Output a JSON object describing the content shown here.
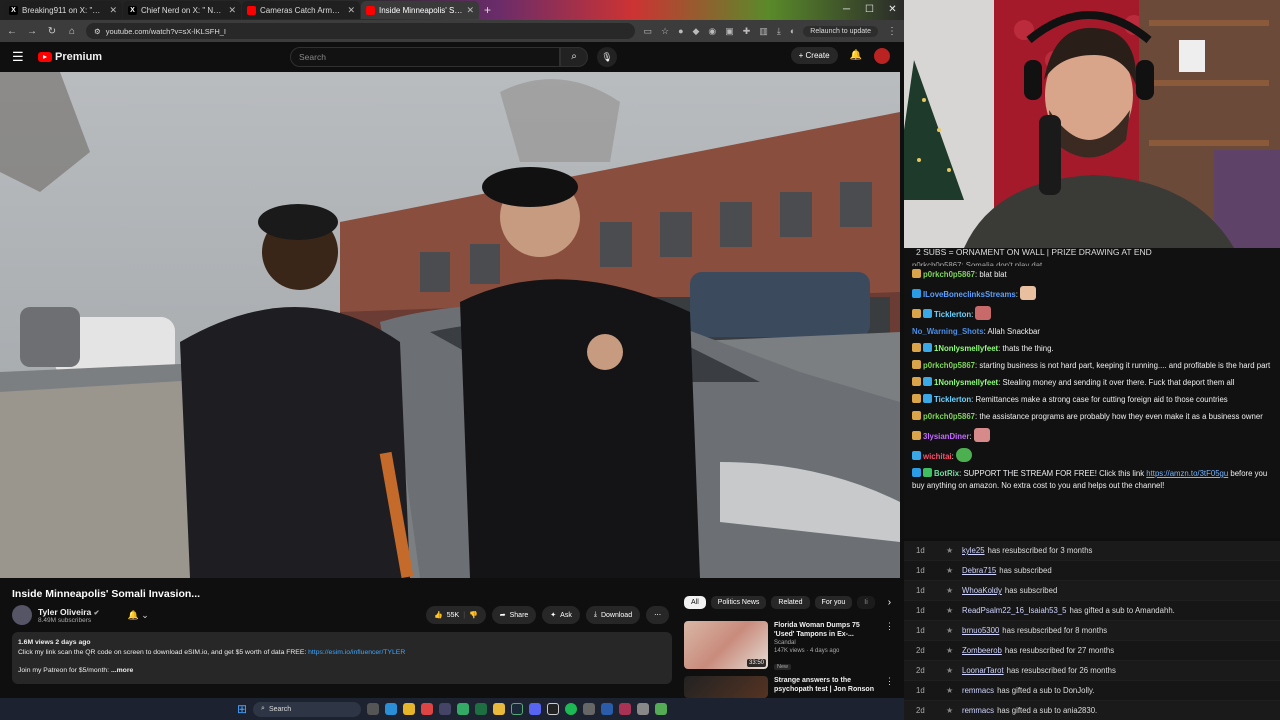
{
  "browser": {
    "tabs": [
      {
        "title": "Breaking911 on X: \"Rep. C",
        "favicon": "x-icon"
      },
      {
        "title": "Chief Nerd on X: \" NEW",
        "favicon": "x-icon"
      },
      {
        "title": "Cameras Catch Armed Robber",
        "favicon": "youtube-icon"
      },
      {
        "title": "Inside Minneapolis' Somali",
        "favicon": "youtube-icon",
        "active": true
      }
    ],
    "url": "youtube.com/watch?v=sX-lKLSFH_I",
    "relaunch_label": "Relaunch to update"
  },
  "youtube": {
    "brand": "Premium",
    "search_placeholder": "Search",
    "create_label": "Create",
    "video_title": "Inside Minneapolis' Somali Invasion...",
    "channel_name": "Tyler Oliveira",
    "channel_subs": "8.49M subscribers",
    "likes": "55K",
    "share_label": "Share",
    "ask_label": "Ask",
    "download_label": "Download",
    "description": {
      "meta": "1.6M views  2 days ago",
      "line1": "Click my link scan the QR code on screen to download eSIM.io, and get $5 worth of data FREE: ",
      "link": "https://esim.io/influencer/TYLER",
      "line2": "Join my Patreon for $5/month:",
      "more": "...more"
    },
    "chips": [
      "All",
      "Politics News",
      "Related",
      "For you",
      "Ii"
    ],
    "recommendations": [
      {
        "title": "Florida Woman Dumps 75 'Used' Tampons in Ex-...",
        "channel": "Scandal",
        "meta": "147K views · 4 days ago",
        "badge": "New",
        "duration": "33:50"
      },
      {
        "title": "Strange answers to the psychopath test | Jon Ronson ...",
        "channel": "",
        "meta": "",
        "badge": "",
        "duration": ""
      }
    ]
  },
  "taskbar": {
    "search_label": "Search"
  },
  "chat": {
    "banner": "2 SUBS = ORNAMENT ON WALL | PRIZE DRAWING AT END",
    "partial_top": "p0rkch0p5867: Somalia don't play dat",
    "messages": [
      {
        "user": "p0rkch0p5867",
        "color": "#7fd45a",
        "text": "blat blat"
      },
      {
        "user": "ILoveBoneclinksStreams",
        "color": "#5aa0ff",
        "text": ""
      },
      {
        "user": "Ticklerton",
        "color": "#6ad3ff",
        "text": ""
      },
      {
        "user": "No_Warning_Shots",
        "color": "#4b8ee6",
        "text": "Allah Snackbar"
      },
      {
        "user": "1Nonlysmellyfeet",
        "color": "#8eff7a",
        "text": "thats the thing."
      },
      {
        "user": "p0rkch0p5867",
        "color": "#7fd45a",
        "text": "starting business is not hard part, keeping it running.... and profitable is the hard part"
      },
      {
        "user": "1Nonlysmellyfeet",
        "color": "#8eff7a",
        "text": "Stealing money and sending it over there. Fuck that deport them all"
      },
      {
        "user": "Ticklerton",
        "color": "#6ad3ff",
        "text": "Remittances make a strong case for cutting foreign aid to those countries"
      },
      {
        "user": "p0rkch0p5867",
        "color": "#7fd45a",
        "text": "the assistance programs are probably how they even make it as a business owner"
      },
      {
        "user": "3lysianDiner",
        "color": "#c46bff",
        "text": ""
      },
      {
        "user": "wichitai",
        "color": "#ff4d6a",
        "text": ""
      },
      {
        "user": "BotRix",
        "color": "#6fe0a0",
        "text": "SUPPORT THE STREAM FOR FREE! Click this link ",
        "link": "https://amzn.to/3tF05gu",
        "after": " before you buy anything on amazon. No extra cost to you and helps out the channel!"
      }
    ]
  },
  "events": [
    {
      "time": "1d",
      "user": "kyle25",
      "text": "has resubscribed for 3 months"
    },
    {
      "time": "1d",
      "user": "Debra715",
      "text": "has subscribed"
    },
    {
      "time": "1d",
      "user": "WhoaKoldy",
      "text": "has subscribed"
    },
    {
      "time": "1d",
      "user": "ReadPsalm22_16_Isaiah53_5",
      "text": "has gifted a sub to Amandahh."
    },
    {
      "time": "1d",
      "user": "brnuo5300",
      "text": "has resubscribed for 8 months"
    },
    {
      "time": "2d",
      "user": "Zombeerob",
      "text": "has resubscribed for 27 months"
    },
    {
      "time": "2d",
      "user": "LoonarTarot",
      "text": "has resubscribed for 26 months"
    },
    {
      "time": "1d",
      "user": "remmacs",
      "text": "has gifted a sub to DonJolly."
    },
    {
      "time": "2d",
      "user": "remmacs",
      "text": "has gifted a sub to ania2830."
    }
  ]
}
